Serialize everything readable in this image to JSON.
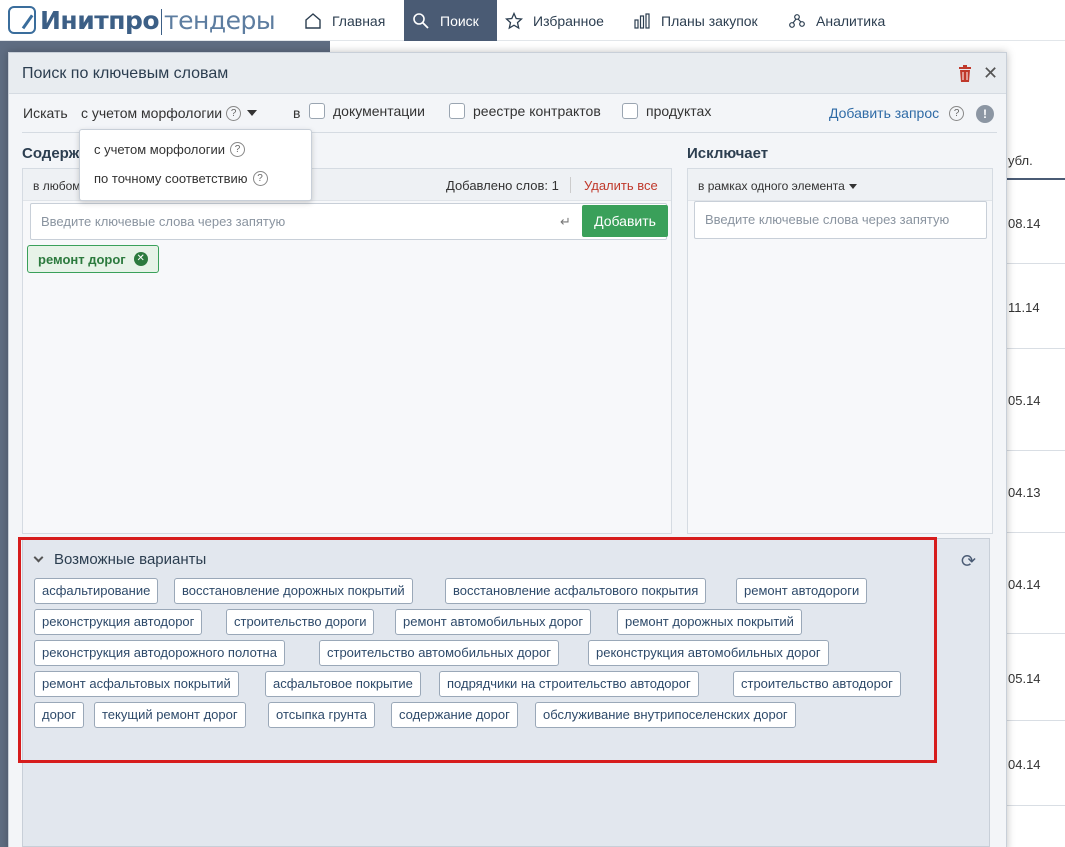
{
  "nav": {
    "logo_bold": "Инитпро",
    "logo_light": "тендеры",
    "items": [
      {
        "label": "Главная",
        "icon": "home-icon"
      },
      {
        "label": "Поиск",
        "icon": "search-icon",
        "active": true
      },
      {
        "label": "Избранное",
        "icon": "star-icon"
      },
      {
        "label": "Планы закупок",
        "icon": "bar-chart-icon"
      },
      {
        "label": "Аналитика",
        "icon": "analytics-icon"
      }
    ]
  },
  "background": {
    "column_header": "убл.",
    "dates": [
      "08.14",
      "11.14",
      "05.14",
      "04.13",
      "04.14",
      "05.14",
      "04.14"
    ]
  },
  "modal": {
    "title": "Поиск по ключевым словам",
    "search_label": "Искать",
    "mode_selected": "с учетом морфологии",
    "in_label": "в",
    "checkboxes": [
      "документации",
      "реестре контрактов",
      "продуктах"
    ],
    "add_query": "Добавить запрос",
    "dropdown_options": [
      "с учетом морфологии",
      "по точному соответствию"
    ]
  },
  "contains": {
    "title": "Содерж",
    "scope": "в любом",
    "count": "Добавлено слов: 1",
    "delete_all": "Удалить все",
    "placeholder": "Введите ключевые слова через запятую",
    "add_button": "Добавить",
    "tags": [
      "ремонт дорог"
    ]
  },
  "excludes": {
    "title": "Исключает",
    "scope": "в рамках одного элемента",
    "placeholder": "Введите ключевые слова через запятую"
  },
  "variants": {
    "title": "Возможные варианты",
    "rows": [
      [
        "асфальтирование",
        "восстановление дорожных покрытий",
        "восстановление асфальтового покрытия",
        "ремонт автодороги"
      ],
      [
        "реконструкция автодорог",
        "строительство дороги",
        "ремонт автомобильных дорог",
        "ремонт дорожных покрытий"
      ],
      [
        "реконструкция автодорожного полотна",
        "строительство автомобильных дорог",
        "реконструкция автомобильных дорог"
      ],
      [
        "ремонт асфальтовых покрытий",
        "асфальтовое покрытие",
        "подрядчики на строительство автодорог",
        "строительство автодорог"
      ],
      [
        "дорог",
        "текущий ремонт дорог",
        "отсыпка грунта",
        "содержание дорог",
        "обслуживание внутрипоселенских дорог"
      ]
    ]
  },
  "colors": {
    "nav_active": "#4a5b74",
    "add_button": "#3aa05a",
    "delete_link": "#c0392b",
    "highlight": "#d61c1c",
    "link": "#2f6ba6"
  }
}
